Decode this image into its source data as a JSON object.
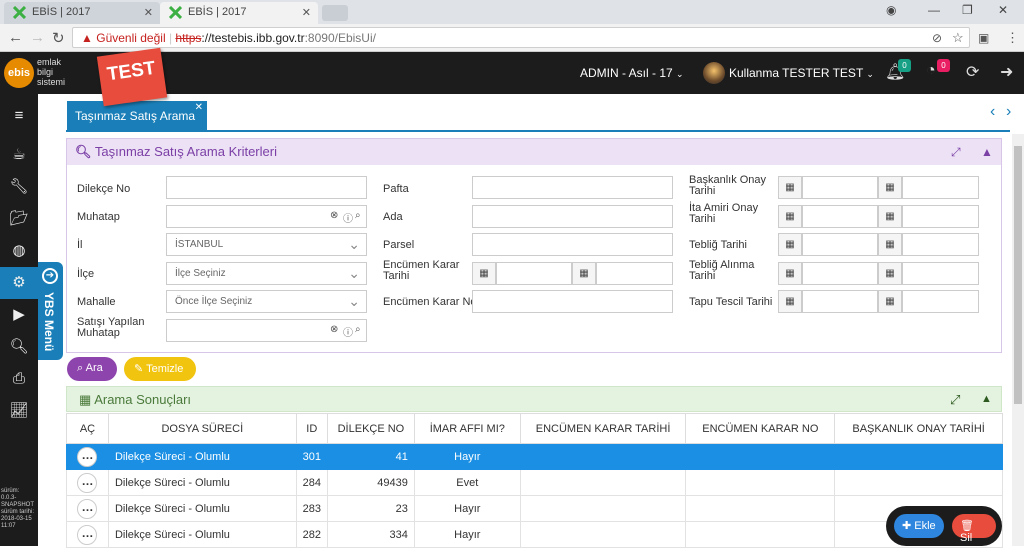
{
  "browser": {
    "tabs": [
      {
        "title": "EBİS | 2017"
      },
      {
        "title": "EBİS | 2017"
      }
    ],
    "security": "Güvenli değil",
    "url_scheme": "https",
    "url_host": "://testebis.ibb.gov.tr",
    "url_path": ":8090/EbisUi/"
  },
  "header": {
    "logo_badge": "ebis",
    "logo_lines": [
      "emlak",
      "bilgi",
      "sistemi"
    ],
    "env_ribbon": "TEST",
    "role": "ADMIN - Asıl - 17",
    "user": "Kullanma TESTER TEST",
    "notif_count_1": "0",
    "notif_count_2": "0"
  },
  "sidebar": {
    "ybs_label": "YBS Menü",
    "version_lines": [
      "sürüm:",
      "0.0.3-",
      "SNAPSHOT",
      "sürüm tarihi:",
      "2018-03-15",
      "11:07"
    ]
  },
  "content_tab": {
    "title": "Taşınmaz Satış Arama"
  },
  "criteria": {
    "title": "Taşınmaz Satış Arama Kriterleri",
    "col1": [
      {
        "label": "Dilekçe No",
        "value": ""
      },
      {
        "label": "Muhatap",
        "value": ""
      },
      {
        "label": "İl",
        "value": "İSTANBUL"
      },
      {
        "label": "İlçe",
        "value": "İlçe Seçiniz"
      },
      {
        "label": "Mahalle",
        "value": "Önce İlçe Seçiniz"
      },
      {
        "label": "Satışı Yapılan Muhatap",
        "value": ""
      }
    ],
    "col2": [
      {
        "label": "Pafta"
      },
      {
        "label": "Ada"
      },
      {
        "label": "Parsel"
      },
      {
        "label": "Encümen Karar Tarihi"
      },
      {
        "label": "Encümen Karar No"
      }
    ],
    "col3": [
      {
        "label": "Başkanlık Onay Tarihi"
      },
      {
        "label": "İta Amiri Onay Tarihi"
      },
      {
        "label": "Tebliğ Tarihi"
      },
      {
        "label": "Tebliğ Alınma Tarihi"
      },
      {
        "label": "Tapu Tescil Tarihi"
      }
    ]
  },
  "buttons": {
    "search": "Ara",
    "clear": "Temizle",
    "add": "Ekle",
    "delete": "Sil"
  },
  "results": {
    "title": "Arama Sonuçları",
    "columns": [
      "AÇ",
      "DOSYA SÜRECİ",
      "ID",
      "DİLEKÇE NO",
      "İMAR AFFI MI?",
      "ENCÜMEN KARAR TARİHİ",
      "ENCÜMEN KARAR NO",
      "BAŞKANLIK ONAY TARİHİ"
    ],
    "rows": [
      {
        "process": "Dilekçe Süreci - Olumlu",
        "id": "301",
        "petition_no": "41",
        "imar": "Hayır",
        "enc_date": "",
        "enc_no": "",
        "bsk_date": "",
        "selected": true
      },
      {
        "process": "Dilekçe Süreci - Olumlu",
        "id": "284",
        "petition_no": "49439",
        "imar": "Evet",
        "enc_date": "",
        "enc_no": "",
        "bsk_date": "",
        "selected": false
      },
      {
        "process": "Dilekçe Süreci - Olumlu",
        "id": "283",
        "petition_no": "23",
        "imar": "Hayır",
        "enc_date": "",
        "enc_no": "",
        "bsk_date": "",
        "selected": false
      },
      {
        "process": "Dilekçe Süreci - Olumlu",
        "id": "282",
        "petition_no": "334",
        "imar": "Hayır",
        "enc_date": "",
        "enc_no": "",
        "bsk_date": "",
        "selected": false
      }
    ]
  },
  "colors": {
    "accent": "#1a7fb8",
    "search_btn": "#8e44ad",
    "clear_btn": "#f1c40f",
    "add_btn": "#2e86de",
    "delete_btn": "#e74c3c"
  }
}
